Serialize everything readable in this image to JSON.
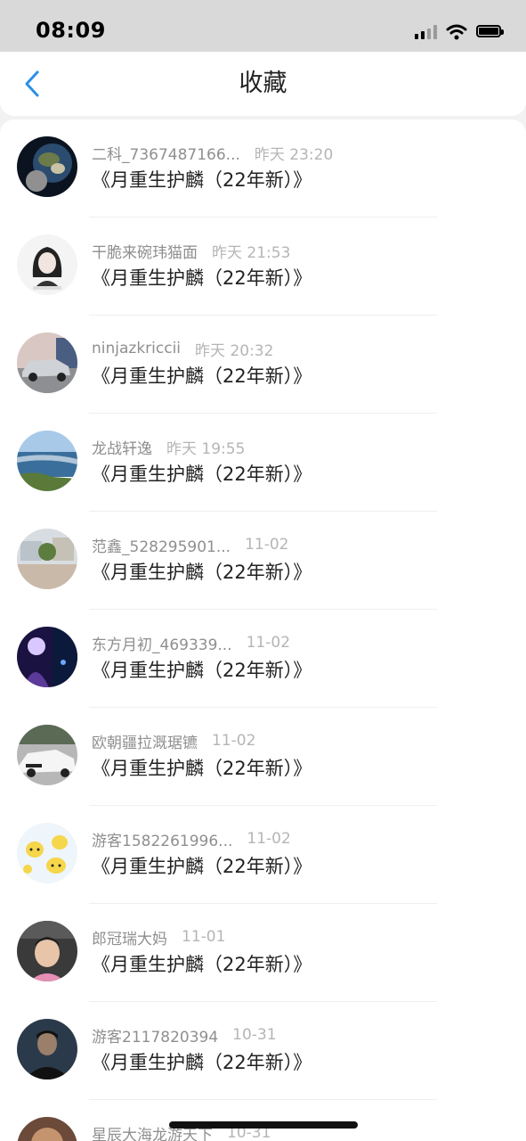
{
  "status_bar": {
    "time": "08:09"
  },
  "header": {
    "title": "收藏",
    "back_icon": "chevron-left-icon",
    "accent_color": "#2a8fe6"
  },
  "items": [
    {
      "name": "二科_7367487166...",
      "time": "昨天 23:20",
      "title": "《月重生护麟（22年新）》",
      "avatar": "earth-from-space-avatar"
    },
    {
      "name": "干脆来碗玮猫面",
      "time": "昨天 21:53",
      "title": "《月重生护麟（22年新）》",
      "avatar": "girl-sketch-avatar"
    },
    {
      "name": "ninjazkriccii",
      "time": "昨天 20:32",
      "title": "《月重生护麟（22年新）》",
      "avatar": "car-avatar"
    },
    {
      "name": "龙战轩逸",
      "time": "昨天 19:55",
      "title": "《月重生护麟（22年新）》",
      "avatar": "seashore-avatar"
    },
    {
      "name": "范鑫_528295901...",
      "time": "11-02",
      "title": "《月重生护麟（22年新）》",
      "avatar": "street-avatar"
    },
    {
      "name": "东方月初_469339...",
      "time": "11-02",
      "title": "《月重生护麟（22年新）》",
      "avatar": "anime-night-avatar"
    },
    {
      "name": "欧朝疆拉溉琚镳",
      "time": "11-02",
      "title": "《月重生护麟（22年新）》",
      "avatar": "white-car-avatar"
    },
    {
      "name": "游客1582261996...",
      "time": "11-02",
      "title": "《月重生护麟（22年新）》",
      "avatar": "pikachu-avatar"
    },
    {
      "name": "郎冠瑞大妈",
      "time": "11-01",
      "title": "《月重生护麟（22年新）》",
      "avatar": "child-avatar"
    },
    {
      "name": "游客2117820394",
      "time": "10-31",
      "title": "《月重生护麟（22年新）》",
      "avatar": "man-dark-avatar"
    },
    {
      "name": "星辰大海龙游天下",
      "time": "10-31",
      "title": "",
      "avatar": "partial-avatar"
    }
  ]
}
